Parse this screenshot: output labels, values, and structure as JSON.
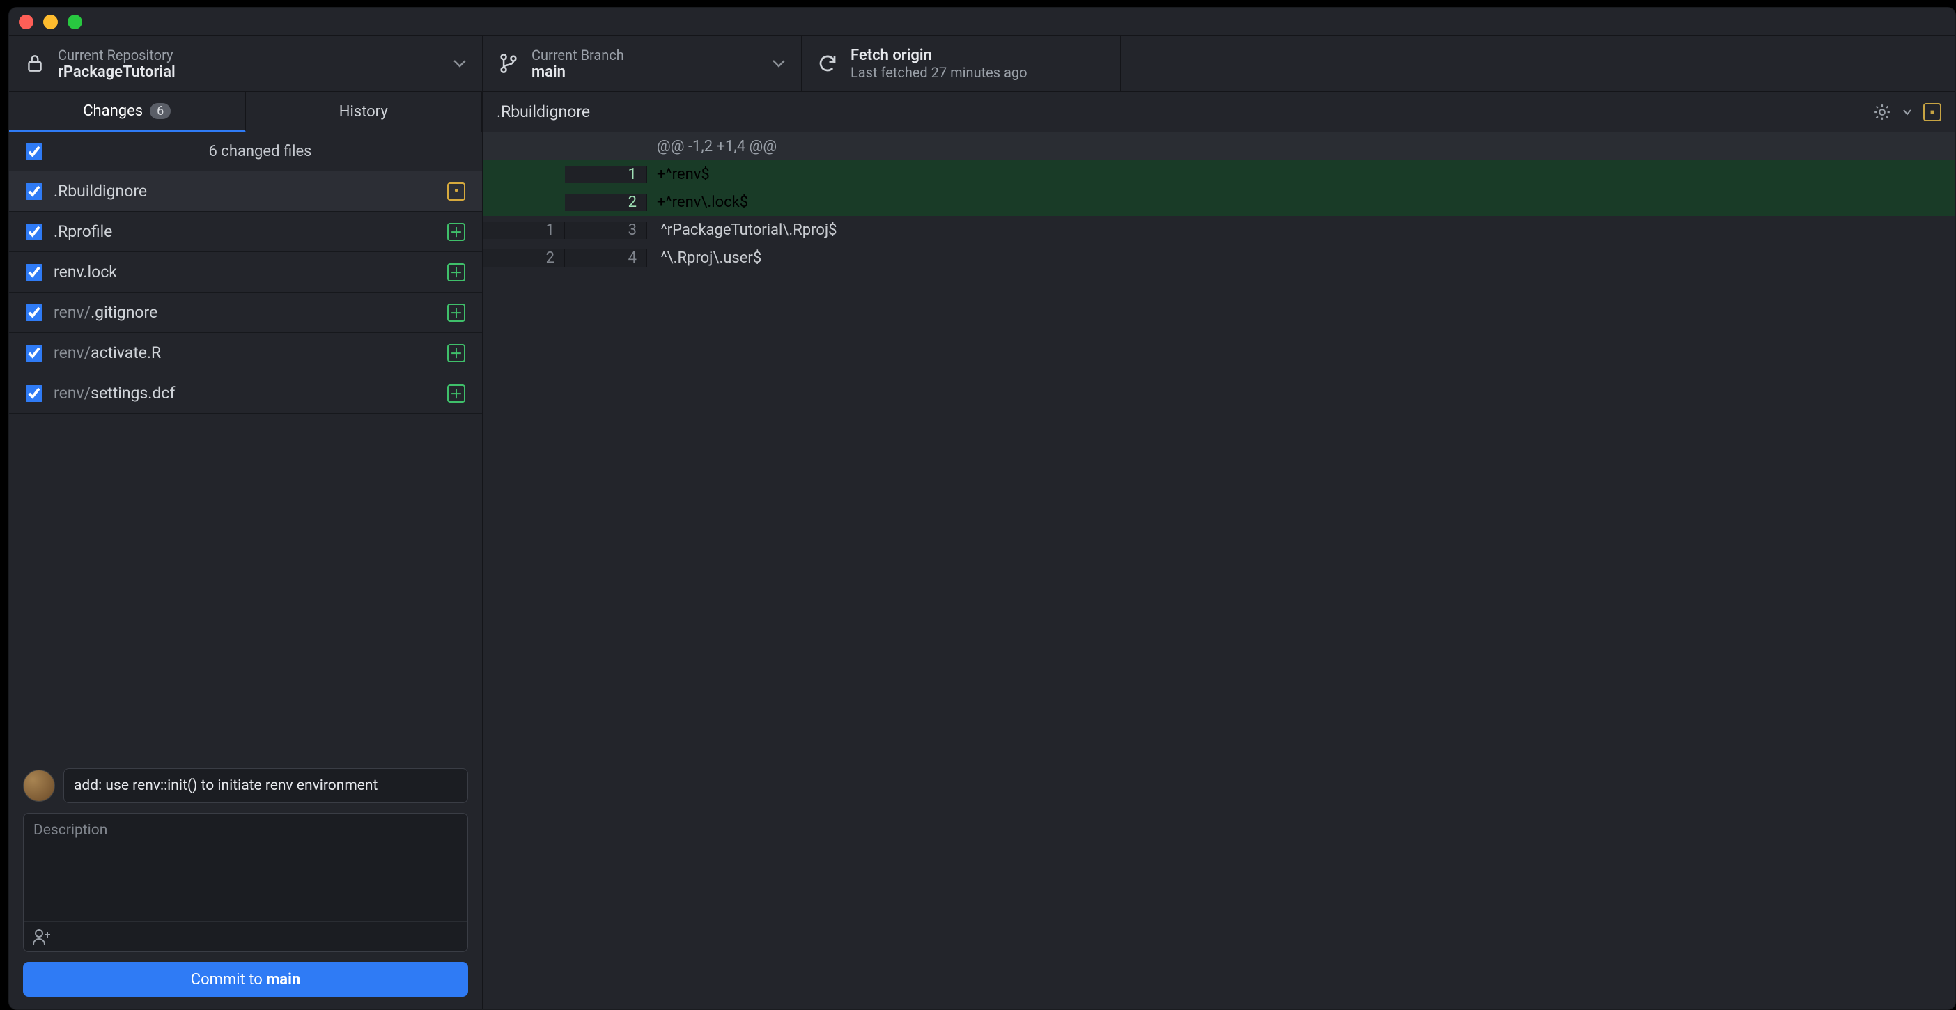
{
  "toolbar": {
    "repo_label": "Current Repository",
    "repo_name": "rPackageTutorial",
    "branch_label": "Current Branch",
    "branch_name": "main",
    "fetch_title": "Fetch origin",
    "fetch_sub": "Last fetched 27 minutes ago"
  },
  "tabs": {
    "changes_label": "Changes",
    "changes_count": "6",
    "history_label": "History"
  },
  "summary": {
    "text": "6 changed files"
  },
  "files": [
    {
      "name": ".Rbuildignore",
      "prefix": "",
      "status": "mod",
      "selected": true
    },
    {
      "name": ".Rprofile",
      "prefix": "",
      "status": "add",
      "selected": false
    },
    {
      "name": "renv.lock",
      "prefix": "",
      "status": "add",
      "selected": false
    },
    {
      "name": ".gitignore",
      "prefix": "renv/",
      "status": "add",
      "selected": false
    },
    {
      "name": "activate.R",
      "prefix": "renv/",
      "status": "add",
      "selected": false
    },
    {
      "name": "settings.dcf",
      "prefix": "renv/",
      "status": "add",
      "selected": false
    }
  ],
  "commit": {
    "summary_value": "add: use renv::init() to initiate renv environment",
    "desc_placeholder": "Description",
    "button_prefix": "Commit to ",
    "button_branch": "main"
  },
  "diff_header": ".Rbuildignore",
  "diff": {
    "hunk": "@@ -1,2 +1,4 @@",
    "lines": [
      {
        "l": "",
        "r": "1",
        "type": "add",
        "text": "+^renv$"
      },
      {
        "l": "",
        "r": "2",
        "type": "add",
        "text": "+^renv\\.lock$"
      },
      {
        "l": "1",
        "r": "3",
        "type": "ctx",
        "text": " ^rPackageTutorial\\.Rproj$"
      },
      {
        "l": "2",
        "r": "4",
        "type": "ctx",
        "text": " ^\\.Rproj\\.user$"
      }
    ]
  }
}
